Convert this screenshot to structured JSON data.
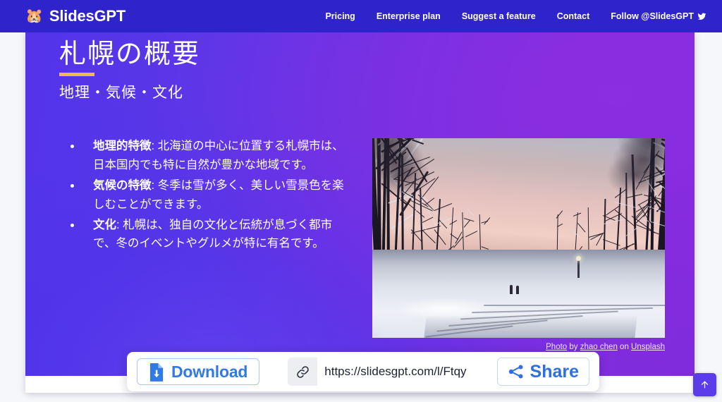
{
  "navbar": {
    "logo_emoji": "🐹",
    "brand": "SlidesGPT",
    "links": [
      {
        "label": "Pricing",
        "name": "pricing"
      },
      {
        "label": "Enterprise plan",
        "name": "enterprise-plan"
      },
      {
        "label": "Suggest a feature",
        "name": "suggest-a-feature"
      },
      {
        "label": "Contact",
        "name": "contact"
      }
    ],
    "follow_label": "Follow @SlidesGPT",
    "background_color": "#2f23cc"
  },
  "slide": {
    "title": "札幌の概要",
    "subtitle": "地理・気候・文化",
    "accent_color": "#eeb94f",
    "background_colors": [
      "#5334e9",
      "#7f2bdb"
    ],
    "bullets": [
      {
        "lead": "地理的特徴",
        "body": ": 北海道の中心に位置する札幌市は、日本国内でも特に自然が豊かな地域です。"
      },
      {
        "lead": "気候の特徴",
        "body": ": 冬季は雪が多く、美しい雪景色を楽しむことができます。"
      },
      {
        "lead": "文化",
        "body": ": 札幌は、独自の文化と伝統が息づく都市で、冬のイベントやグルメが特に有名です。"
      }
    ],
    "photo_alt": "雪の積もった並木道と夕暮れの空",
    "credit": {
      "photo_text": "Photo",
      "by_text": "by",
      "author": "zhao chen",
      "on_text": "on",
      "source": "Unsplash"
    }
  },
  "action_bar": {
    "download_label": "Download",
    "download_icon": "file-download-icon",
    "link_icon": "link-icon",
    "url_value": "https://slidesgpt.com/l/Ftqy",
    "url_placeholder": "https://slidesgpt.com/l/",
    "share_label": "Share",
    "share_icon": "share-nodes-icon"
  },
  "scroll_top": {
    "icon": "arrow-up-icon",
    "color": "#5a3ce8"
  }
}
